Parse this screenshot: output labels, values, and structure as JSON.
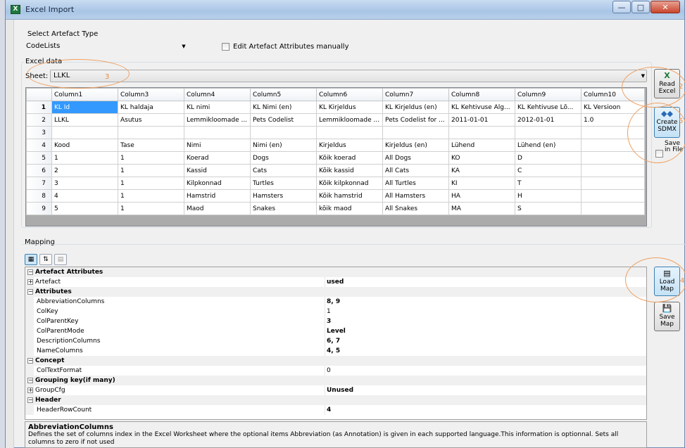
{
  "window": {
    "title": "Excel Import",
    "title_icon": "excel-icon",
    "buttons": [
      "minimize",
      "maximize",
      "close"
    ]
  },
  "artefact": {
    "label": "Select Artefact Type",
    "selected": "CodeLists",
    "edit_manually_label": "Edit Artefact Attributes manually"
  },
  "excel": {
    "group_label": "Excel data",
    "sheet_label": "Sheet:",
    "sheet_value": "LLKL",
    "columns": [
      "Column1",
      "Column3",
      "Column4",
      "Column5",
      "Column6",
      "Column7",
      "Column8",
      "Column9",
      "Column10"
    ],
    "rows": [
      {
        "num": "1",
        "cells": [
          "KL Id",
          "KL haldaja",
          "KL nimi",
          "KL Nimi (en)",
          "KL Kirjeldus",
          "KL Kirjeldus (en)",
          "KL Kehtivuse Alg...",
          "KL Kehtivuse Lõ...",
          "KL Versioon"
        ]
      },
      {
        "num": "2",
        "cells": [
          "LLKL",
          "Asutus",
          "Lemmikloomade ...",
          "Pets Codelist",
          "Lemmikloomade ...",
          "Pets Codelist for ...",
          "2011-01-01",
          "2012-01-01",
          "1.0"
        ]
      },
      {
        "num": "3",
        "cells": [
          "",
          "",
          "",
          "",
          "",
          "",
          "",
          "",
          ""
        ]
      },
      {
        "num": "4",
        "cells": [
          "Kood",
          "Tase",
          "Nimi",
          "Nimi (en)",
          "Kirjeldus",
          "Kirjeldus (en)",
          "Lühend",
          "Lühend (en)",
          ""
        ]
      },
      {
        "num": "5",
        "cells": [
          "1",
          "1",
          "Koerad",
          "Dogs",
          "Kõik koerad",
          "All Dogs",
          "KO",
          "D",
          ""
        ]
      },
      {
        "num": "6",
        "cells": [
          "2",
          "1",
          "Kassid",
          "Cats",
          "Kõik kassid",
          "All Cats",
          "KA",
          "C",
          ""
        ]
      },
      {
        "num": "7",
        "cells": [
          "3",
          "1",
          "Kilpkonnad",
          "Turtles",
          "Kõik kilpkonnad",
          "All Turtles",
          "KI",
          "T",
          ""
        ]
      },
      {
        "num": "8",
        "cells": [
          "4",
          "1",
          "Hamstrid",
          "Hamsters",
          "Kõik hamstrid",
          "All Hamsters",
          "HA",
          "H",
          ""
        ]
      },
      {
        "num": "9",
        "cells": [
          "5",
          "1",
          "Maod",
          "Snakes",
          "kõik maod",
          "All Snakes",
          "MA",
          "S",
          ""
        ]
      }
    ]
  },
  "side_buttons": {
    "read_excel": "Read Excel",
    "create_sdmx": "Create SDMX",
    "save_in_file": "Save in File",
    "load_map": "Load Map",
    "save_map": "Save Map"
  },
  "annotations": [
    "3",
    "2",
    "5",
    "4"
  ],
  "mapping": {
    "label": "Mapping",
    "properties": [
      {
        "kind": "cat",
        "expander": "⊟",
        "name": "Artefact Attributes"
      },
      {
        "kind": "item",
        "expander": "⊞",
        "name": "Artefact",
        "value": "used",
        "bold": true
      },
      {
        "kind": "cat",
        "expander": "⊟",
        "name": "Attributes"
      },
      {
        "kind": "item",
        "name": "AbbreviationColumns",
        "value": "8, 9",
        "bold": true
      },
      {
        "kind": "item",
        "name": "ColKey",
        "value": "1",
        "bold": false
      },
      {
        "kind": "item",
        "name": "ColParentKey",
        "value": "3",
        "bold": true
      },
      {
        "kind": "item",
        "name": "ColParentMode",
        "value": "Level",
        "bold": true
      },
      {
        "kind": "item",
        "name": "DescriptionColumns",
        "value": "6, 7",
        "bold": true
      },
      {
        "kind": "item",
        "name": "NameColumns",
        "value": "4, 5",
        "bold": true
      },
      {
        "kind": "cat",
        "expander": "⊟",
        "name": "Concept"
      },
      {
        "kind": "item",
        "name": "ColTextFormat",
        "value": "0",
        "bold": false
      },
      {
        "kind": "cat",
        "expander": "⊟",
        "name": "Grouping key(if many)"
      },
      {
        "kind": "item",
        "expander": "⊞",
        "name": "GroupCfg",
        "value": "Unused",
        "bold": true
      },
      {
        "kind": "cat",
        "expander": "⊟",
        "name": "Header"
      },
      {
        "kind": "item",
        "name": "HeaderRowCount",
        "value": "4",
        "bold": true
      }
    ],
    "description_title": "AbbreviationColumns",
    "description_text": "Defines the set of columns index in the Excel Worksheet where the optional items Abbreviation (as Annotation) is given in each supported language.This information is optionnal. Sets all columns to zero if not used"
  }
}
